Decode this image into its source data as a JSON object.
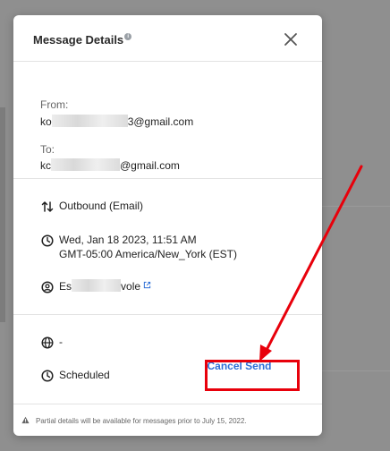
{
  "modal": {
    "title": "Message Details",
    "from_label": "From:",
    "from_prefix": "ko",
    "from_suffix": "3@gmail.com",
    "to_label": "To:",
    "to_prefix": "kc",
    "to_suffix": "@gmail.com",
    "direction": "Outbound (Email)",
    "datetime_line1": "Wed, Jan 18 2023, 11:51 AM",
    "datetime_line2": "GMT-05:00 America/New_York (EST)",
    "contact_prefix": "Es",
    "contact_suffix": "vole",
    "channel_value": "-",
    "status": "Scheduled",
    "cancel_button": "Cancel Send",
    "footer_note": "Partial details will be available for messages prior to July 15, 2022."
  },
  "colors": {
    "accent": "#2e6fd6",
    "annotation": "#e8000b"
  },
  "icons": [
    "info-icon",
    "close-icon",
    "swap-vertical-icon",
    "clock-icon",
    "user-circle-icon",
    "external-link-icon",
    "globe-icon",
    "warning-icon"
  ]
}
